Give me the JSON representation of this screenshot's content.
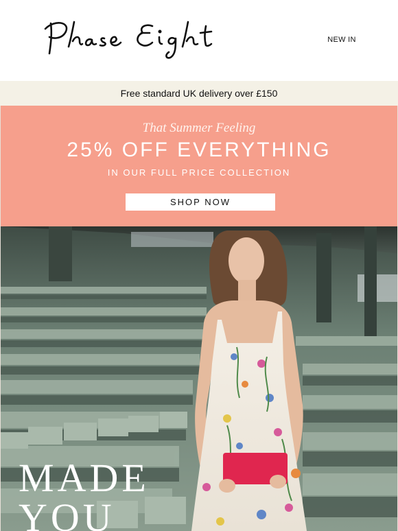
{
  "header": {
    "brand": "Phase Eight",
    "nav_new_in": "NEW IN"
  },
  "delivery_banner": {
    "text": "Free standard UK delivery over £150"
  },
  "promo": {
    "tagline": "That Summer Feeling",
    "headline": "25% OFF EVERYTHING",
    "subline": "IN OUR FULL PRICE COLLECTION",
    "cta_label": "SHOP NOW",
    "background_color": "#f69f8c"
  },
  "hero": {
    "line1": "MADE",
    "line2": "YOU"
  }
}
